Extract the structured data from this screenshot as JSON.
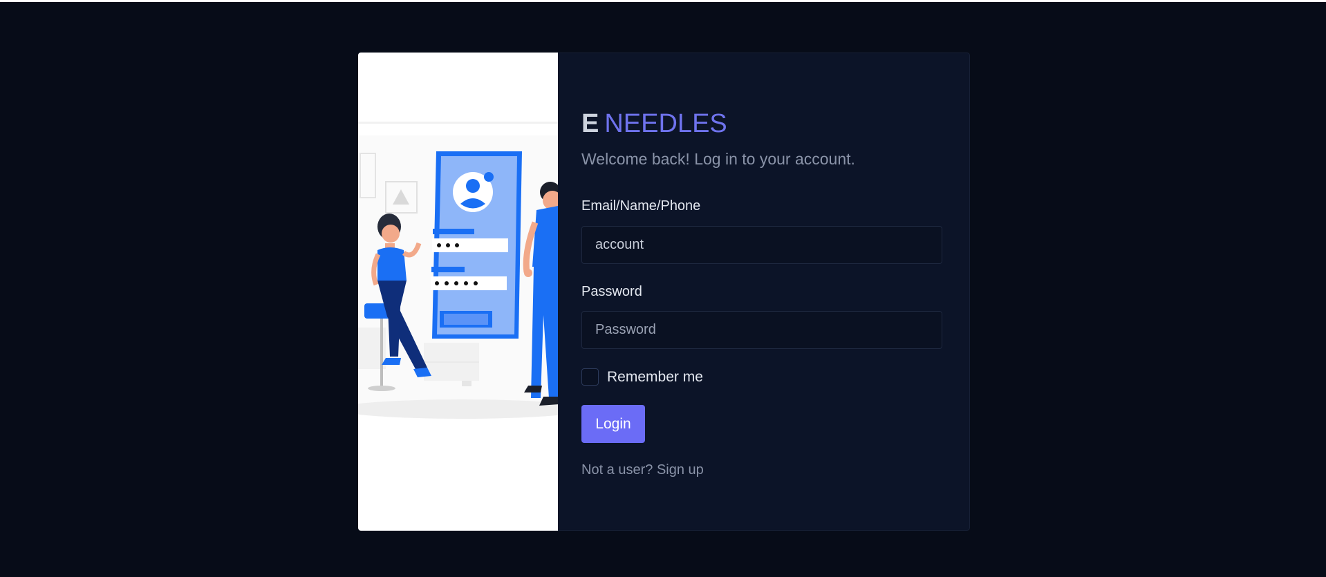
{
  "brand": {
    "prefix": "E",
    "name": "NEEDLES"
  },
  "subtitle": "Welcome back! Log in to your account.",
  "form": {
    "email_label": "Email/Name/Phone",
    "email_value": "account",
    "password_label": "Password",
    "password_placeholder": "Password",
    "remember_label": "Remember me",
    "remember_checked": false,
    "login_label": "Login",
    "signup_prompt": "Not a user?",
    "signup_link": "Sign up"
  },
  "colors": {
    "page_background": "#070c18",
    "panel_background": "#0c1428",
    "accent": "#6b6cf6",
    "illustration_blue": "#1a6ff4"
  }
}
